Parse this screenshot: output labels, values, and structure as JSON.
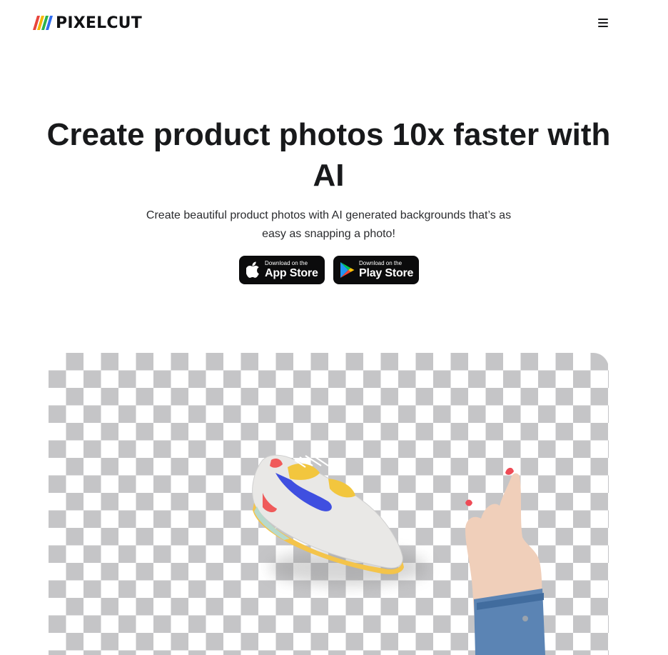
{
  "header": {
    "logo_text": "PIXELCUT",
    "logo_colors": [
      "#e8453c",
      "#f5b800",
      "#2ab24d",
      "#2f6df0"
    ],
    "menu_icon": "hamburger-menu-icon"
  },
  "hero": {
    "title": "Create product photos 10x faster with AI",
    "subtitle": "Create beautiful product photos with AI generated backgrounds that’s as easy as snapping a photo!"
  },
  "store_buttons": [
    {
      "small": "Download on the",
      "big": "App Store",
      "icon": "apple-icon"
    },
    {
      "small": "Download on the",
      "big": "Play Store",
      "icon": "google-play-icon"
    }
  ],
  "showcase": {
    "checker_color": "#c5c5c7",
    "content": [
      "sneaker-image",
      "pointing-hand-image"
    ]
  }
}
